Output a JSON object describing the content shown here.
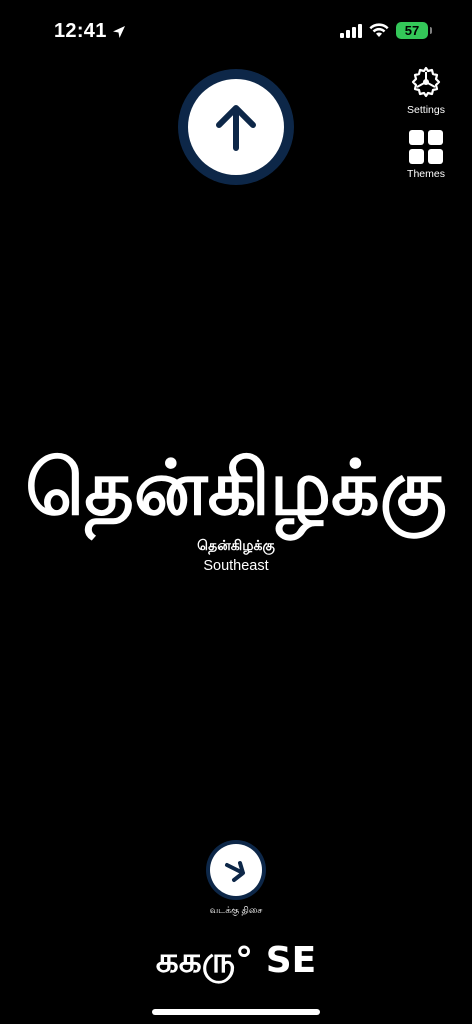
{
  "status_bar": {
    "time": "12:41",
    "battery": "57",
    "colors": {
      "battery": "#34c759"
    }
  },
  "controls": {
    "settings_label": "Settings",
    "themes_label": "Themes"
  },
  "direction": {
    "tamil_big": "தென்கிழக்கு",
    "tamil_small": "தென்கிழக்கு",
    "english": "Southeast"
  },
  "secondary": {
    "label": "வடக்கு திசை"
  },
  "heading": {
    "readout": "ககரு° SE"
  },
  "theme": {
    "arrow_ring": "#0d2748",
    "background": "#000000"
  }
}
